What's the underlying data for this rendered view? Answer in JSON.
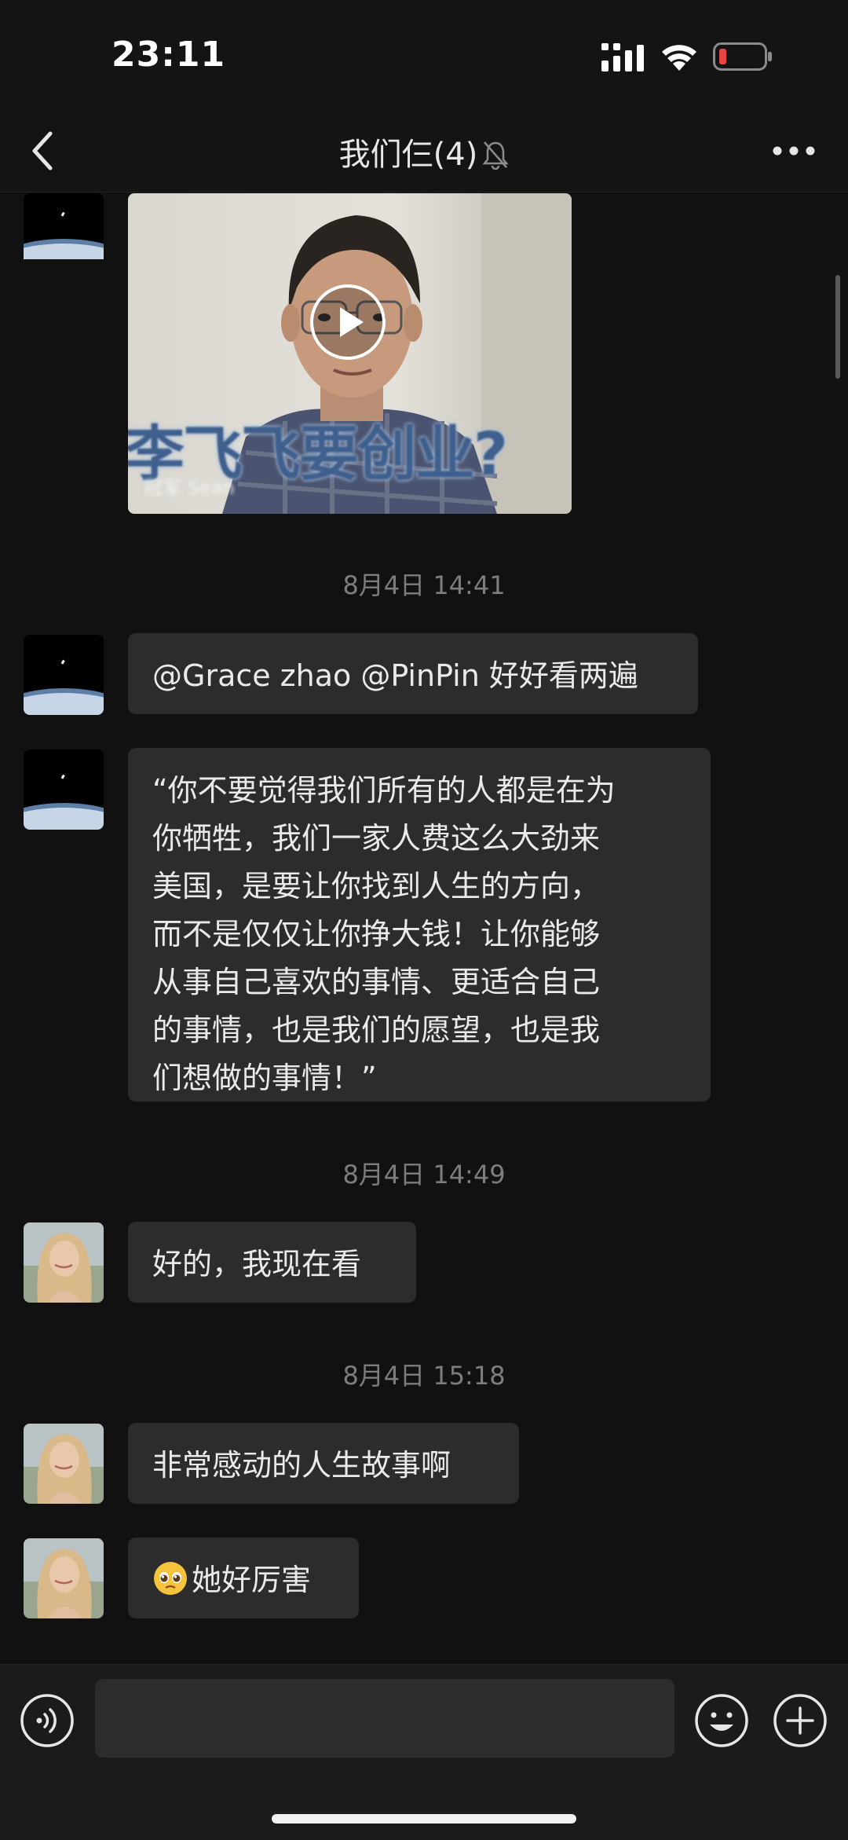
{
  "status_bar": {
    "time": "23:11"
  },
  "header": {
    "title": "我们仨(4)"
  },
  "video": {
    "caption": "李飞飞要创业?",
    "watermark": "冠军 Sean"
  },
  "messages": [
    {
      "timestamp": "8月4日 14:41"
    },
    {
      "sender": "space-avatar",
      "text": "@Grace zhao @PinPin 好好看两遍"
    },
    {
      "sender": "space-avatar",
      "text": "“你不要觉得我们所有的人都是在为\n你牺牲，我们一家人费这么大劲来\n美国，是要让你找到人生的方向，\n而不是仅仅让你挣大钱！让你能够\n从事自己喜欢的事情、更适合自己\n的事情，也是我们的愿望，也是我\n们想做的事情！”"
    },
    {
      "timestamp": "8月4日 14:49"
    },
    {
      "sender": "woman-avatar",
      "text": "好的，我现在看"
    },
    {
      "timestamp": "8月4日 15:18"
    },
    {
      "sender": "woman-avatar",
      "text": "非常感动的人生故事啊"
    },
    {
      "sender": "woman-avatar",
      "emoji": "pleading-face-emoji",
      "text": "她好厉害"
    }
  ],
  "input": {
    "value": ""
  },
  "colors": {
    "background": "#111111",
    "bubble": "#2c2c2c",
    "battery_low": "#e8463f"
  },
  "icons": [
    "back-icon",
    "mute-bell-icon",
    "more-icon",
    "play-icon",
    "voice-icon",
    "emoji-icon",
    "plus-icon"
  ]
}
